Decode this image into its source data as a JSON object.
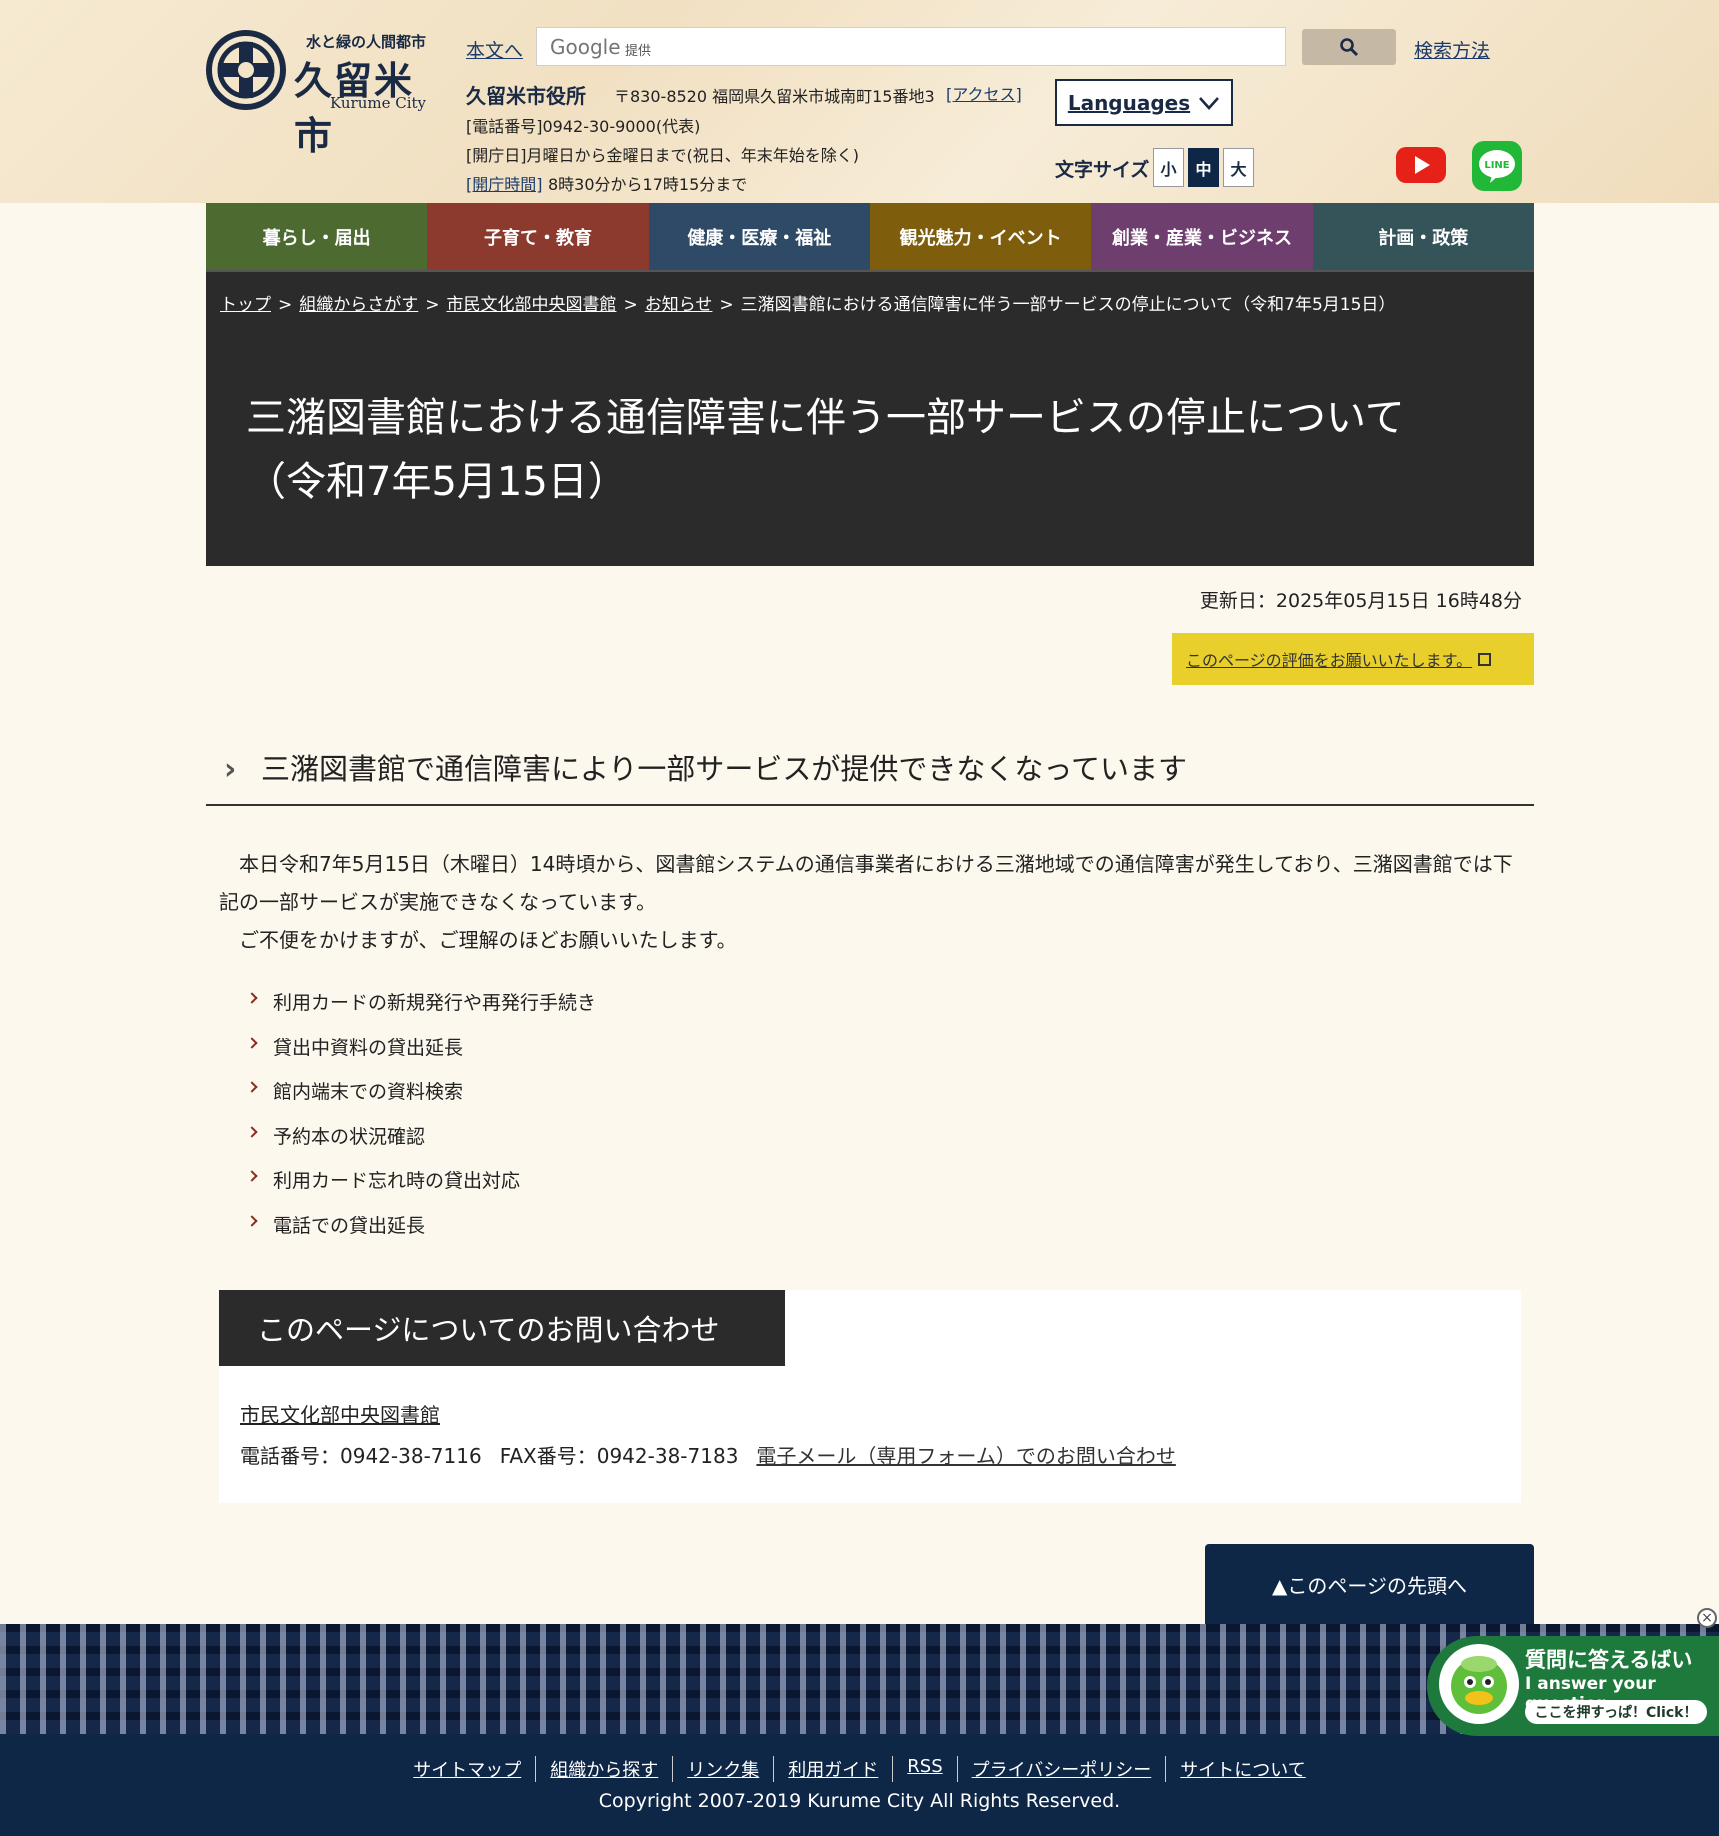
{
  "header": {
    "logo": {
      "tagline": "水と緑の人間都市",
      "name": "久留米市",
      "name_en": "Kurume City"
    },
    "skip_link": "本文へ",
    "search": {
      "brand": "Google",
      "brand_sub": "提供",
      "help_link": "検索方法"
    },
    "office": {
      "name": "久留米市役所",
      "address": "〒830-8520 福岡県久留米市城南町15番地3",
      "access_link": "[アクセス]",
      "phone": "[電話番号]0942-30-9000(代表)",
      "days": "[開庁日]月曜日から金曜日まで(祝日、年末年始を除く)",
      "hours_link": "[開庁時間]",
      "hours": "8時30分から17時15分まで"
    },
    "languages_label": "Languages",
    "font_size": {
      "label": "文字サイズ",
      "small": "小",
      "medium": "中",
      "large": "大"
    }
  },
  "nav": {
    "items": [
      {
        "label": "暮らし・届出",
        "color": "#4d6b31"
      },
      {
        "label": "子育て・教育",
        "color": "#8d3a2e"
      },
      {
        "label": "健康・医療・福祉",
        "color": "#2f4a66"
      },
      {
        "label": "観光魅力・イベント",
        "color": "#7e5d0d"
      },
      {
        "label": "創業・産業・ビジネス",
        "color": "#6d3e6e"
      },
      {
        "label": "計画・政策",
        "color": "#35545a"
      }
    ]
  },
  "breadcrumb": {
    "items": [
      "トップ",
      "組織からさがす",
      "市民文化部中央図書館",
      "お知らせ"
    ],
    "current": "三潴図書館における通信障害に伴う一部サービスの停止について（令和7年5月15日）",
    "separator": ">"
  },
  "page": {
    "title_line1": "三潴図書館における通信障害に伴う一部サービスの停止について",
    "title_line2": "（令和7年5月15日）",
    "updated": "更新日：2025年05月15日 16時48分",
    "rating_link": "このページの評価をお願いいたします。",
    "section_heading": "三潴図書館で通信障害により一部サービスが提供できなくなっています",
    "paragraph1": "　本日令和7年5月15日（木曜日）14時頃から、図書館システムの通信事業者における三潴地域での通信障害が発生しており、三潴図書館では下記の一部サービスが実施できなくなっています。",
    "paragraph2": "　ご不便をかけますが、ご理解のほどお願いいたします。",
    "services": [
      "利用カードの新規発行や再発行手続き",
      "貸出中資料の貸出延長",
      "館内端末での資料検索",
      "予約本の状況確認",
      "利用カード忘れ時の貸出対応",
      "電話での貸出延長"
    ]
  },
  "contact": {
    "heading": "このページについてのお問い合わせ",
    "department": "市民文化部中央図書館",
    "phone": "電話番号：0942-38-7116",
    "fax": "FAX番号：0942-38-7183",
    "email_link": "電子メール（専用フォーム）でのお問い合わせ"
  },
  "back_to_top": "▲このページの先頭へ",
  "footer": {
    "links": [
      "サイトマップ",
      "組織から探す",
      "リンク集",
      "利用ガイド",
      "RSS",
      "プライバシーポリシー",
      "サイトについて"
    ],
    "copyright": "Copyright 2007-2019 Kurume City All Rights Reserved."
  },
  "chatbot": {
    "title": "質問に答えるばい",
    "subtitle": "I answer your question",
    "click": "ここを押すっぱ！Click！",
    "close": "×"
  },
  "icons": {
    "search": "search-icon",
    "chevron": "chevron-down-icon",
    "youtube": "youtube-icon",
    "line": "line-icon"
  }
}
